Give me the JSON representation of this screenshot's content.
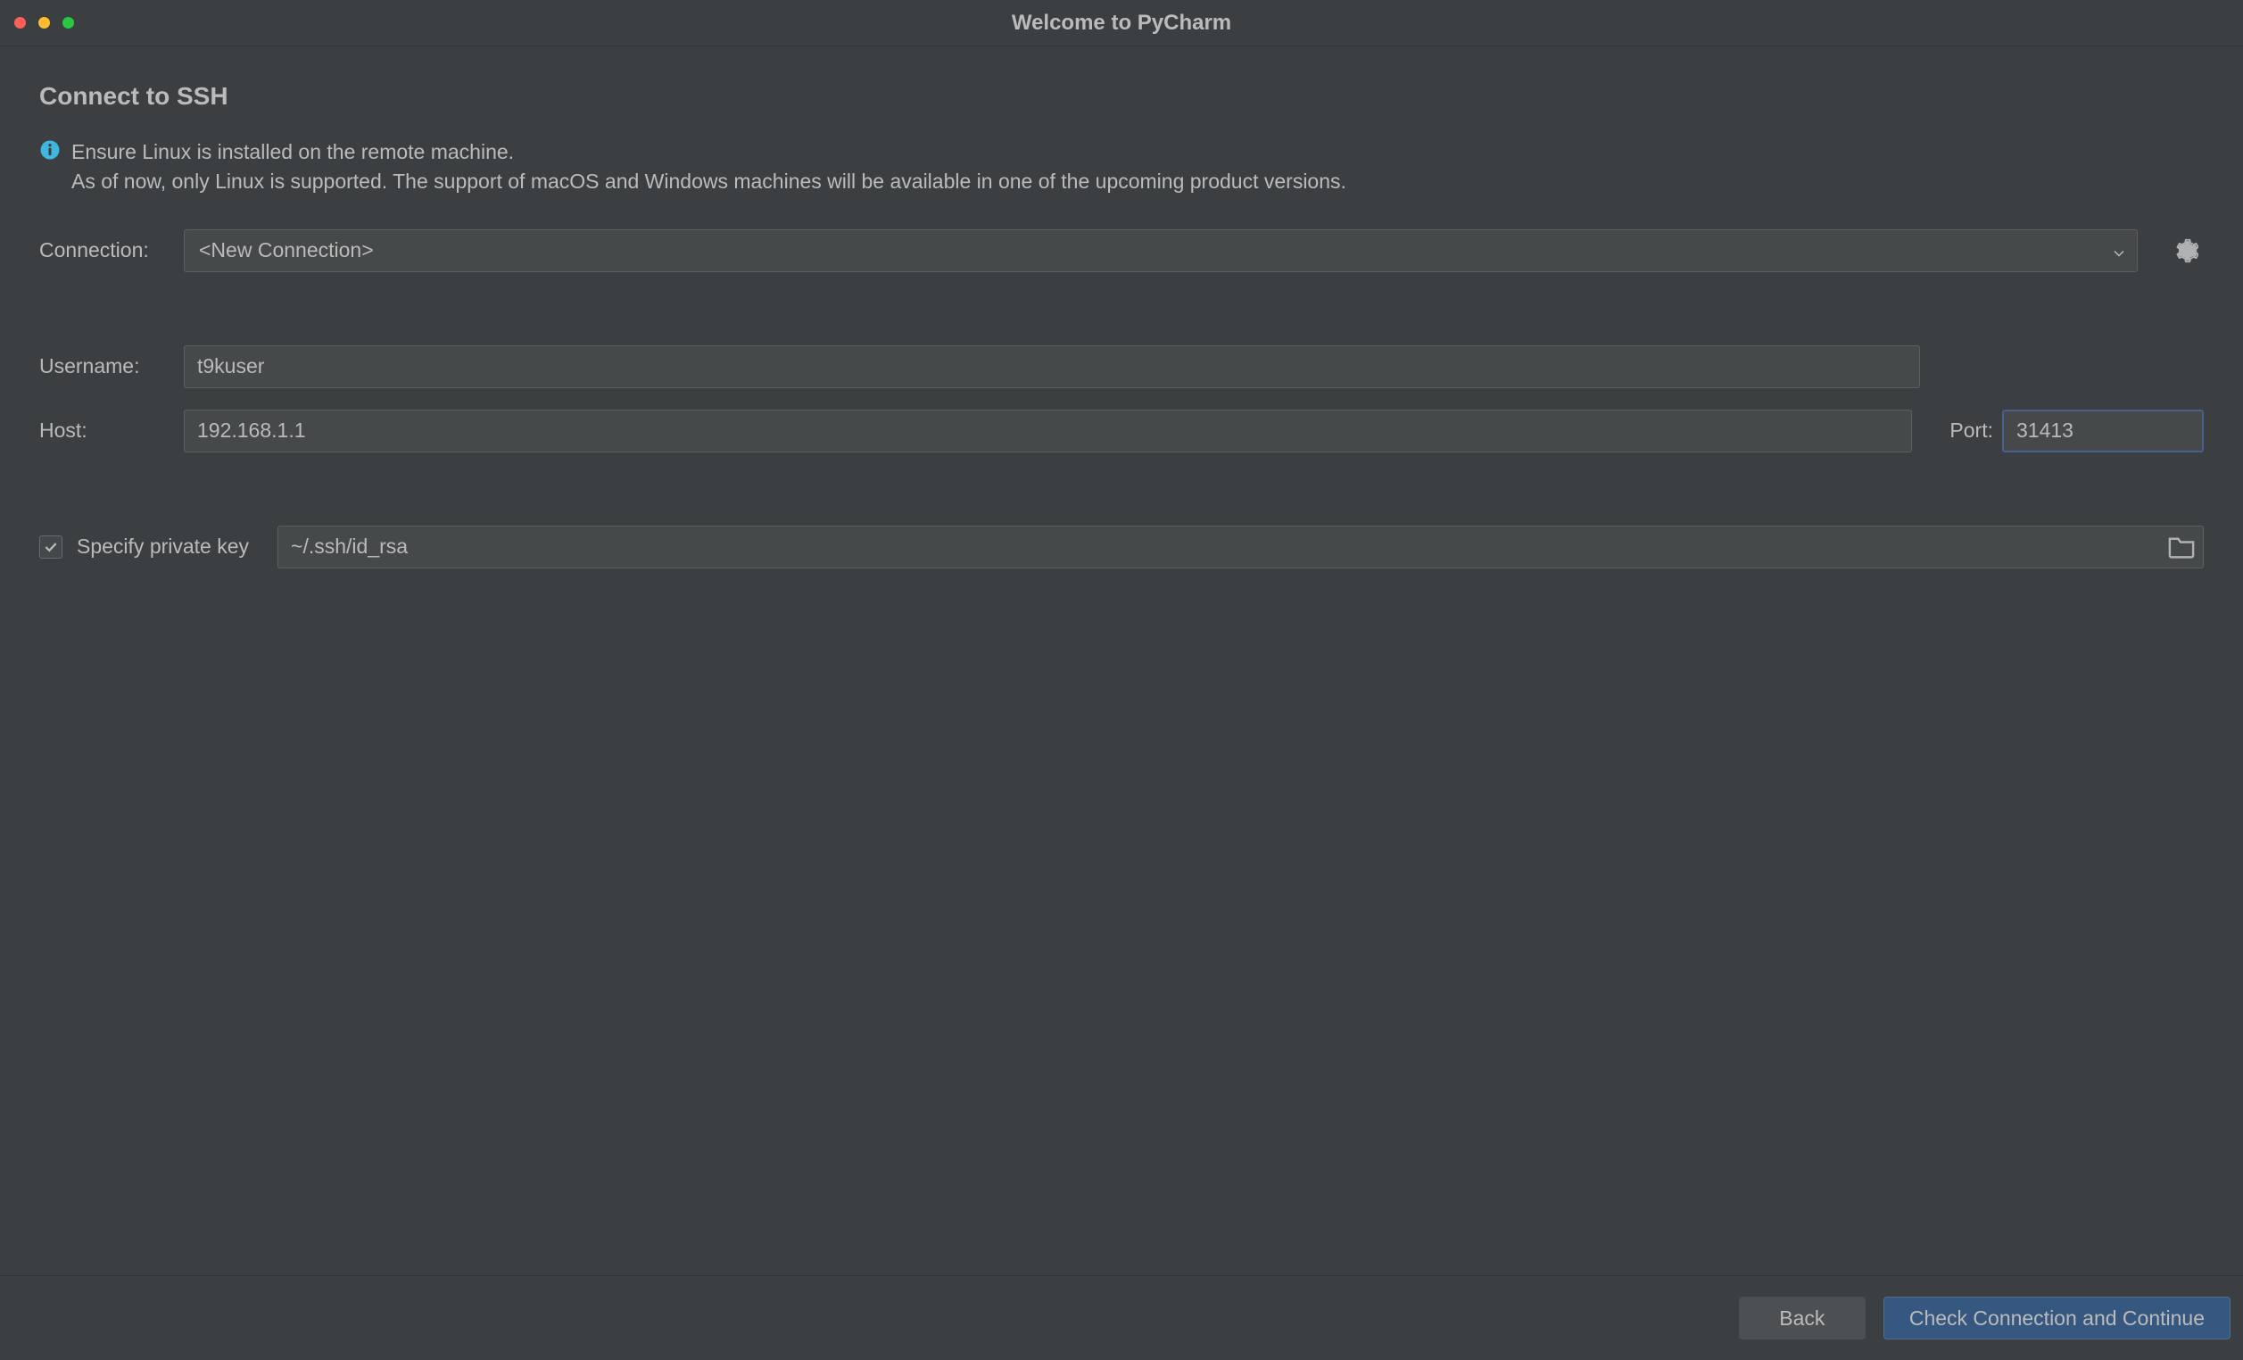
{
  "window": {
    "title": "Welcome to PyCharm"
  },
  "page": {
    "title": "Connect to SSH"
  },
  "info": {
    "line1": "Ensure Linux is installed on the remote machine.",
    "line2": "As of now, only Linux is supported. The support of macOS and Windows machines will be available in one of the upcoming product versions."
  },
  "form": {
    "connection_label": "Connection:",
    "connection_value": "<New Connection>",
    "username_label": "Username:",
    "username_value": "t9kuser",
    "host_label": "Host:",
    "host_value": "192.168.1.1",
    "port_label": "Port:",
    "port_value": "31413",
    "private_key_checkbox_label": "Specify private key",
    "private_key_value": "~/.ssh/id_rsa",
    "private_key_checked": true
  },
  "footer": {
    "back_label": "Back",
    "continue_label": "Check Connection and Continue"
  },
  "icons": {
    "info": "info-icon",
    "gear": "gear-icon",
    "dropdown": "chevron-down-icon",
    "folder": "folder-icon",
    "check": "check-icon"
  }
}
